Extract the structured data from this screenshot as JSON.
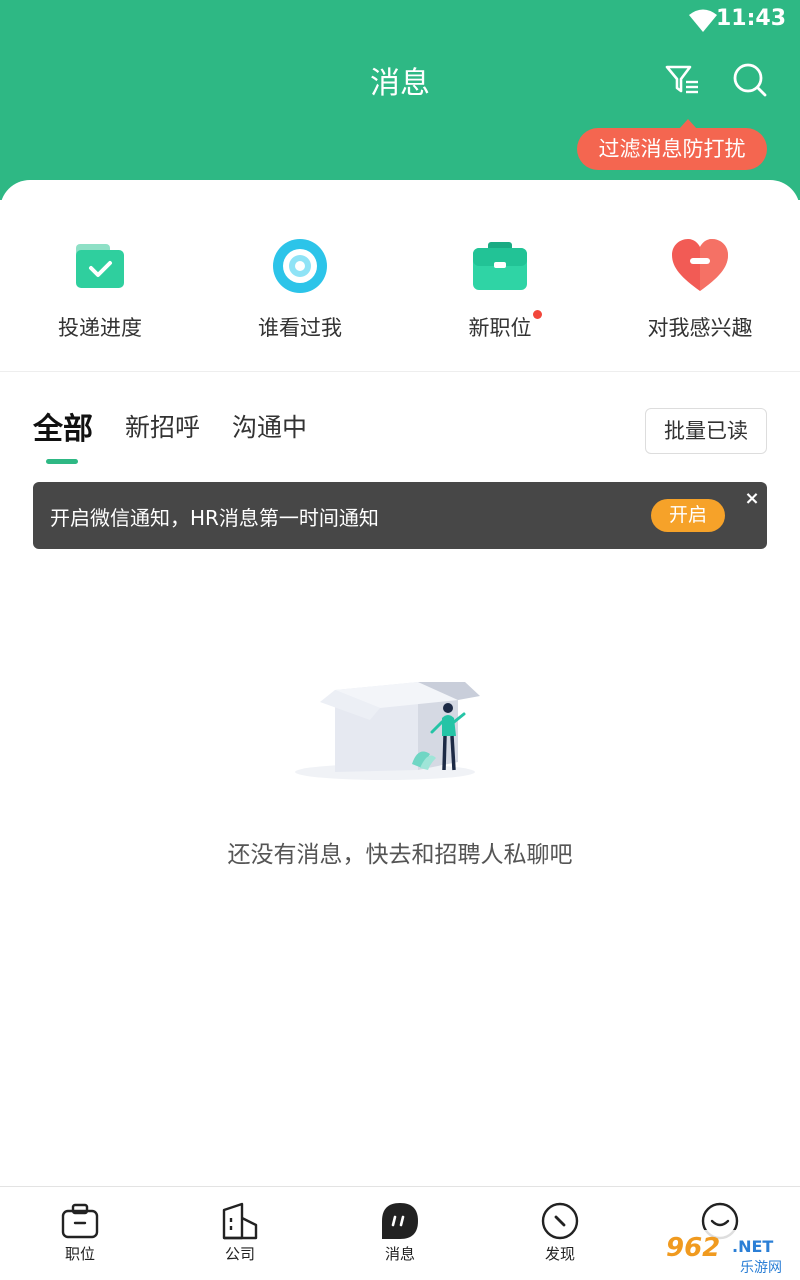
{
  "status_bar": {
    "time": "11:43"
  },
  "header": {
    "title": "消息",
    "tooltip": "过滤消息防打扰",
    "icons": [
      "filter-icon",
      "search-icon"
    ],
    "background_color": "#2eb884"
  },
  "quick_entries": [
    {
      "label": "投递进度",
      "icon": "folder-check-icon"
    },
    {
      "label": "谁看过我",
      "icon": "eye-ring-icon"
    },
    {
      "label": "新职位",
      "icon": "briefcase-icon",
      "badge": "red-dot"
    },
    {
      "label": "对我感兴趣",
      "icon": "heart-icon"
    }
  ],
  "tabs": {
    "items": [
      "全部",
      "新招呼",
      "沟通中"
    ],
    "active": "全部",
    "batch_read_label": "批量已读"
  },
  "banner": {
    "text": "开启微信通知，HR消息第一时间通知",
    "open_label": "开启",
    "close_label": "×"
  },
  "empty_state": {
    "text": "还没有消息，快去和招聘人私聊吧"
  },
  "bottom_nav": {
    "items": [
      {
        "label": "职位",
        "icon": "briefcase-outline-icon"
      },
      {
        "label": "公司",
        "icon": "building-icon"
      },
      {
        "label": "消息",
        "icon": "message-icon",
        "active": true
      },
      {
        "label": "发现",
        "icon": "compass-icon"
      },
      {
        "label": "",
        "icon": "smile-face-icon"
      }
    ]
  },
  "watermark": {
    "top": "962.NET",
    "bottom": "乐游网"
  },
  "colors": {
    "primary": "#2eb884",
    "tooltip": "#f46650",
    "open_button": "#f6a229",
    "banner": "#474747",
    "badge": "#f2473b"
  }
}
